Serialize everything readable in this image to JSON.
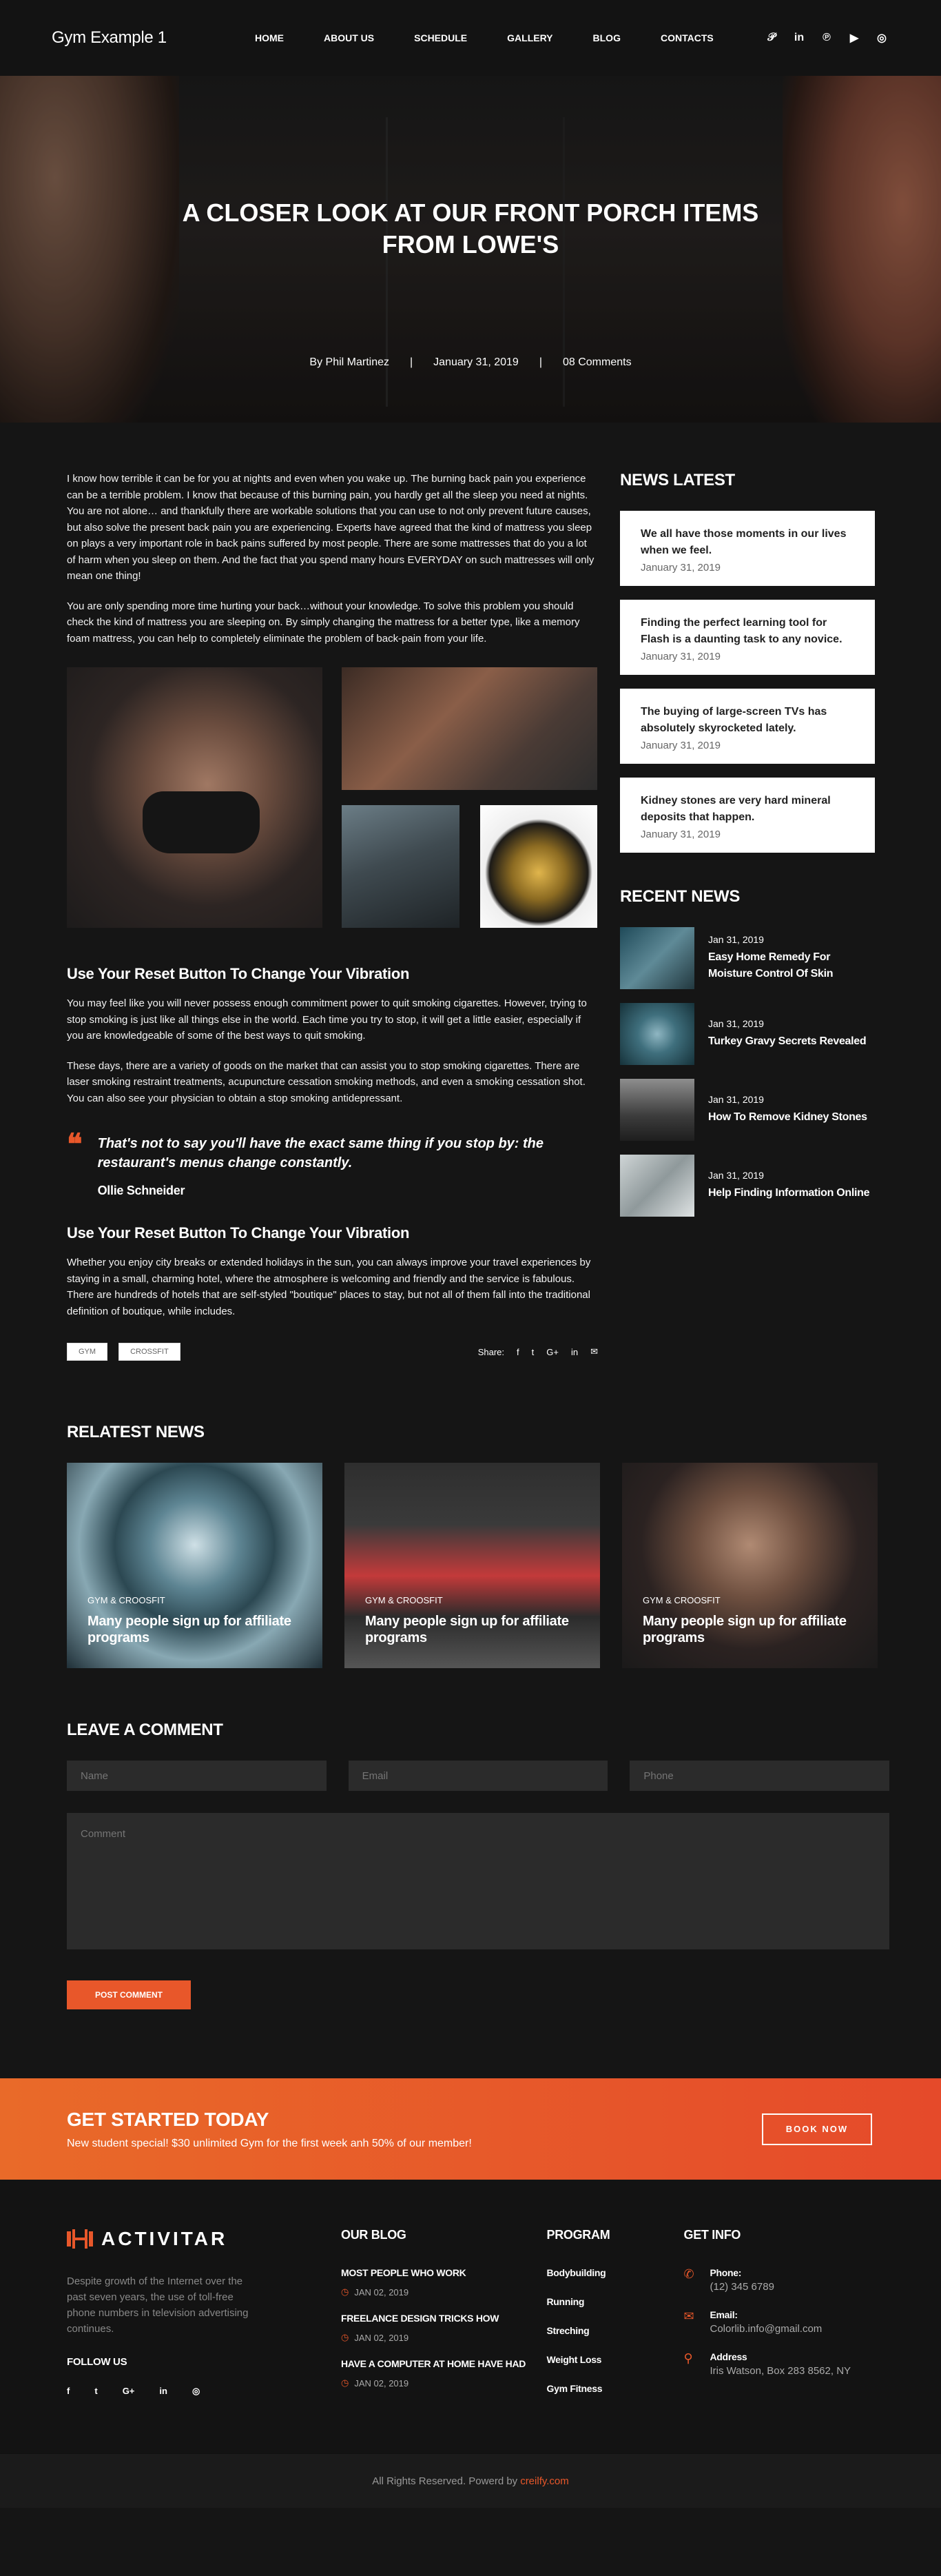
{
  "header": {
    "brand": "Gym Example 1",
    "nav": [
      "HOME",
      "ABOUT US",
      "SCHEDULE",
      "GALLERY",
      "BLOG",
      "CONTACTS"
    ],
    "social_icons": [
      "pinterest-icon",
      "linkedin-icon",
      "pinterest-icon",
      "youtube-icon",
      "instagram-icon"
    ]
  },
  "hero": {
    "title_line1": "A CLOSER LOOK AT OUR FRONT PORCH ITEMS",
    "title_line2": "FROM LOWE'S",
    "author": "By Phil Martinez",
    "sep": "|",
    "date": "January 31, 2019",
    "comments": "08 Comments"
  },
  "article": {
    "p1": "I know how terrible it can be for you at nights and even when you wake up. The burning back pain you experience can be a terrible problem. I know that because of this burning pain, you hardly get all the sleep you need at nights. You are not alone… and thankfully there are workable solutions that you can use to not only prevent future causes, but also solve the present back pain you are experiencing. Experts have agreed that the kind of mattress you sleep on plays a very important role in back pains suffered by most people. There are some mattresses that do you a lot of harm when you sleep on them. And the fact that you spend many hours EVERYDAY on such mattresses will only mean one thing!",
    "p2": "You are only spending more time hurting your back…without your knowledge. To solve this problem you should check the kind of mattress you are sleeping on. By simply changing the mattress for a better type, like a memory foam mattress, you can help to completely eliminate the problem of back-pain from your life.",
    "h1": "Use Your Reset Button To Change Your Vibration",
    "p3": "You may feel like you will never possess enough commitment power to quit smoking cigarettes. However, trying to stop smoking is just like all things else in the world. Each time you try to stop, it will get a little easier, especially if you are knowledgeable of some of the best ways to quit smoking.",
    "p4": "These days, there are a variety of goods on the market that can assist you to stop smoking cigarettes. There are laser smoking restraint treatments, acupuncture cessation smoking methods, and even a smoking cessation shot. You can also see your physician to obtain a stop smoking antidepressant.",
    "quote_mark": "❝",
    "quote": "That's not to say you'll have the exact same thing if you stop by: the restaurant's menus change constantly.",
    "quote_author": "Ollie Schneider",
    "h2": "Use Your Reset Button To Change Your Vibration",
    "p5": "Whether you enjoy city breaks or extended holidays in the sun, you can always improve your travel experiences by staying in a small, charming hotel, where the atmosphere is welcoming and friendly and the service is fabulous. There are hundreds of hotels that are self-styled \"boutique\" places to stay, but not all of them fall into the traditional definition of boutique, while includes.",
    "tags": [
      "GYM",
      "CROSSFIT"
    ],
    "share_label": "Share:",
    "share_icons": [
      "facebook-icon",
      "twitter-icon",
      "google-plus-icon",
      "linkedin-icon",
      "email-icon"
    ]
  },
  "sidebar": {
    "latest_title": "NEWS LATEST",
    "latest": [
      {
        "title": "We all have those moments in our lives when we feel.",
        "date": "January 31, 2019"
      },
      {
        "title": "Finding the perfect learning tool for Flash is a daunting task to any novice.",
        "date": "January 31, 2019"
      },
      {
        "title": "The buying of large-screen TVs has absolutely skyrocketed lately.",
        "date": "January 31, 2019"
      },
      {
        "title": "Kidney stones are very hard mineral deposits that happen.",
        "date": "January 31, 2019"
      }
    ],
    "recent_title": "RECENT NEWS",
    "recent": [
      {
        "date": "Jan 31, 2019",
        "title": "Easy Home Remedy For Moisture Control Of Skin"
      },
      {
        "date": "Jan 31, 2019",
        "title": "Turkey Gravy Secrets Revealed"
      },
      {
        "date": "Jan 31, 2019",
        "title": "How To Remove Kidney Stones"
      },
      {
        "date": "Jan 31, 2019",
        "title": "Help Finding Information Online"
      }
    ]
  },
  "related": {
    "title": "RELATEST NEWS",
    "items": [
      {
        "category": "GYM & CROOSFIT",
        "title": "Many people sign up for affiliate programs"
      },
      {
        "category": "GYM & CROOSFIT",
        "title": "Many people sign up for affiliate programs"
      },
      {
        "category": "GYM & CROOSFIT",
        "title": "Many people sign up for affiliate programs"
      }
    ]
  },
  "comment": {
    "title": "LEAVE A COMMENT",
    "name_placeholder": "Name",
    "email_placeholder": "Email",
    "phone_placeholder": "Phone",
    "comment_placeholder": "Comment",
    "submit": "POST COMMENT"
  },
  "cta": {
    "title": "GET STARTED TODAY",
    "subtitle": "New student special! $30 unlimited Gym for the first week anh 50% of our member!",
    "button": "BOOK NOW"
  },
  "footer": {
    "logo": "ACTIVITAR",
    "description": "Despite growth of the Internet over the past seven years, the use of toll-free phone numbers in television advertising continues.",
    "follow": "FOLLOW US",
    "follow_icons": [
      "f",
      "t",
      "G+",
      "in",
      "◎"
    ],
    "blog_title": "OUR BLOG",
    "blog": [
      {
        "title": "MOST PEOPLE WHO WORK",
        "date": "JAN 02, 2019"
      },
      {
        "title": "FREELANCE DESIGN TRICKS HOW",
        "date": "JAN 02, 2019"
      },
      {
        "title": "HAVE A COMPUTER AT HOME HAVE HAD",
        "date": "JAN 02, 2019"
      }
    ],
    "program_title": "PROGRAM",
    "programs": [
      "Bodybuilding",
      "Running",
      "Streching",
      "Weight Loss",
      "Gym Fitness"
    ],
    "info_title": "GET INFO",
    "phone_label": "Phone:",
    "phone": "(12) 345 6789",
    "email_label": "Email:",
    "email": "Colorlib.info@gmail.com",
    "address_label": "Address",
    "address": "Iris Watson, Box 283 8562, NY",
    "copyright": "All Rights Reserved. Powerd by",
    "copyright_link": "creilfy.com"
  },
  "colors": {
    "accent": "#e8572a",
    "background": "#151515"
  }
}
